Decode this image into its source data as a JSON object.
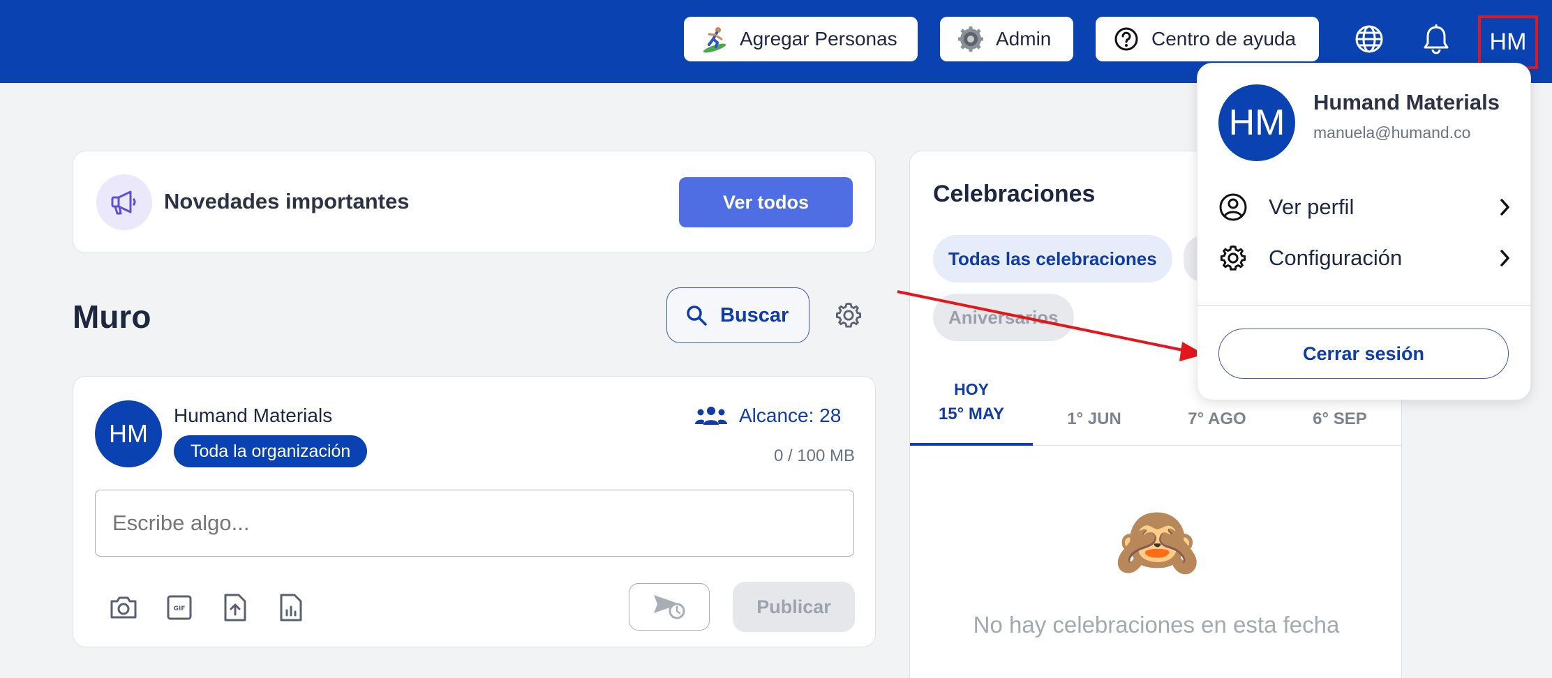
{
  "colors": {
    "primary": "#0a42b2",
    "accent_button": "#4f6ee3",
    "highlight_box": "#e3171b",
    "annotation_arrow": "#e3171b"
  },
  "topbar": {
    "add_people_label": "Agregar Personas",
    "add_people_icon": "surfer-icon",
    "admin_label": "Admin",
    "admin_icon": "gear-icon",
    "help_label": "Centro de ayuda",
    "help_icon": "question-circle-icon",
    "language_icon": "globe-icon",
    "notifications_icon": "bell-icon",
    "user_initials": "HM"
  },
  "news": {
    "icon": "megaphone-icon",
    "title": "Novedades importantes",
    "button_label": "Ver todos"
  },
  "wall": {
    "title": "Muro",
    "search_label": "Buscar",
    "settings_icon": "gear-icon"
  },
  "composer": {
    "avatar_initials": "HM",
    "author_name": "Humand Materials",
    "audience_label": "Toda la organización",
    "reach_label": "Alcance: 28",
    "storage_label": "0 / 100 MB",
    "placeholder": "Escribe algo...",
    "tools": [
      "camera-icon",
      "gif-icon",
      "upload-icon",
      "document-chart-icon"
    ],
    "schedule_icon": "schedule-send-icon",
    "publish_label": "Publicar"
  },
  "celebrations": {
    "title": "Celebraciones",
    "chips": [
      "Todas las celebraciones",
      "Aniversarios"
    ],
    "today_label": "HOY",
    "dates": [
      "15° MAY",
      "1° JUN",
      "7° AGO",
      "6° SEP"
    ],
    "empty_emoji": "🙈",
    "empty_text": "No hay celebraciones en esta fecha"
  },
  "dropdown": {
    "avatar_initials": "HM",
    "name": "Humand Materials",
    "email": "manuela@humand.co",
    "items": [
      {
        "label": "Ver perfil",
        "icon": "user-circle-icon"
      },
      {
        "label": "Configuración",
        "icon": "gear-icon"
      }
    ],
    "logout_label": "Cerrar sesión"
  }
}
